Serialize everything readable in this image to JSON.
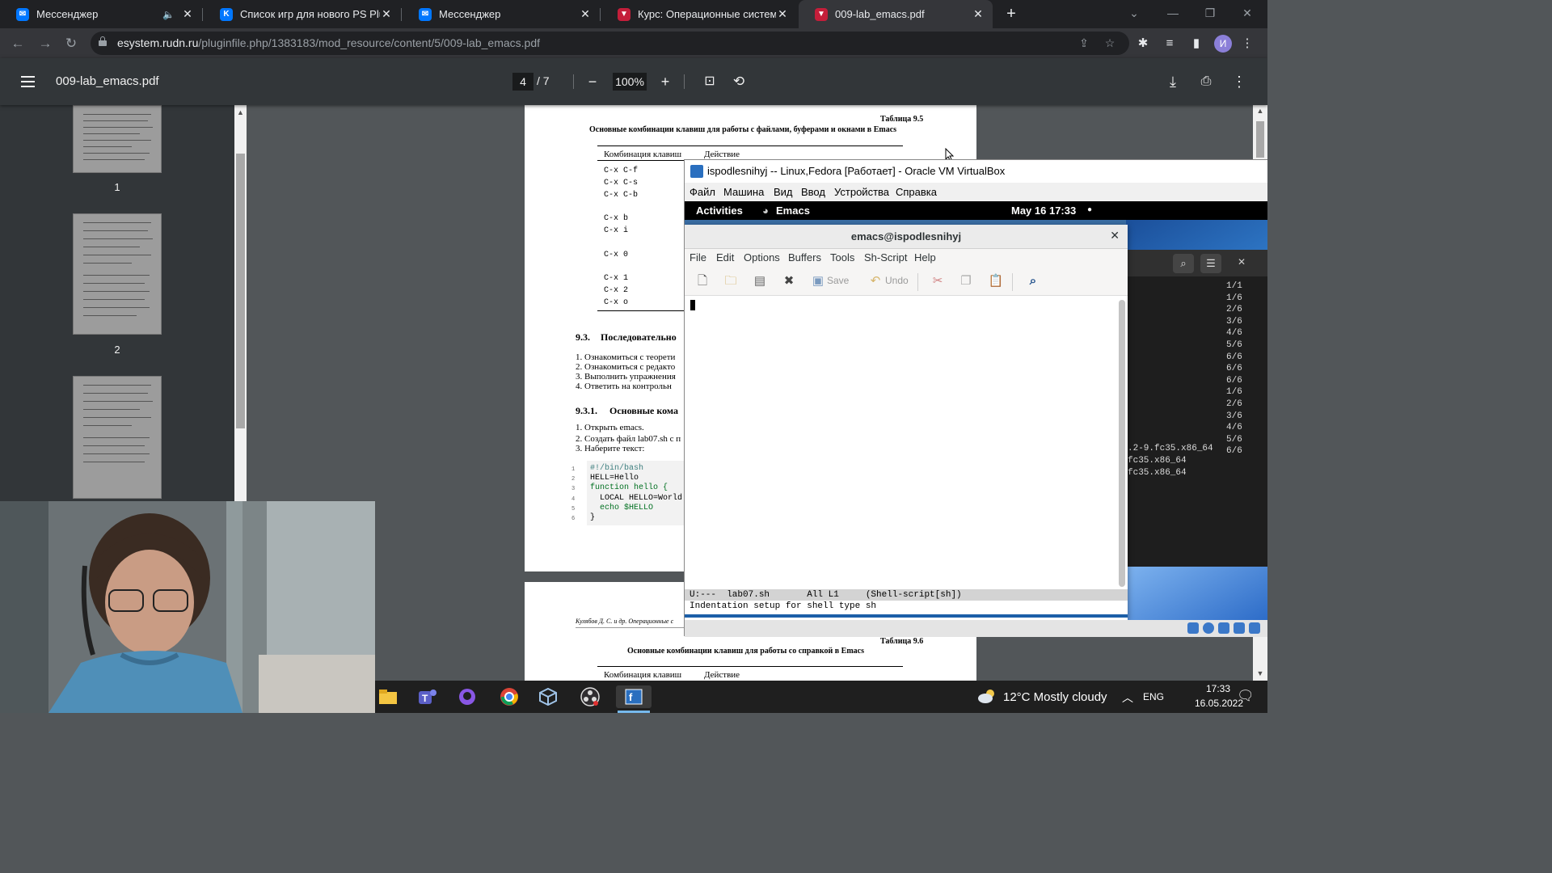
{
  "browser": {
    "tabs": [
      {
        "title": "Мессенджер",
        "icon": "vk-messenger-icon",
        "color": "#0077ff",
        "muted": true
      },
      {
        "title": "Список игр для нового PS Plus",
        "icon": "vk-icon",
        "color": "#0077ff"
      },
      {
        "title": "Мессенджер",
        "icon": "vk-messenger-icon",
        "color": "#0077ff"
      },
      {
        "title": "Курс: Операционные системы (",
        "icon": "rudn-icon",
        "color": "#c41e3a"
      },
      {
        "title": "009-lab_emacs.pdf",
        "icon": "rudn-icon",
        "color": "#c41e3a",
        "active": true
      }
    ],
    "url_host": "esystem.rudn.ru",
    "url_path": "/pluginfile.php/1383183/mod_resource/content/5/009-lab_emacs.pdf",
    "profile_initial": "И"
  },
  "pdf": {
    "filename": "009-lab_emacs.pdf",
    "current_page": "4",
    "total_pages": "/  7",
    "zoom": "100%",
    "thumbnails": [
      "1",
      "2"
    ]
  },
  "page": {
    "table_label": "Таблица 9.5",
    "table_title": "Основные комбинации клавиш для работы с файлами, буферами и окнами в Emacs",
    "col_keys": "Комбинация клавиш",
    "col_action": "Действие",
    "keys": [
      "C-x C-f",
      "C-x C-s",
      "C-x C-b",
      "C-x b",
      "C-x i",
      "C-x 0",
      "C-x 1",
      "C-x 2",
      "C-x o"
    ],
    "section": "9.3.",
    "section_title": "Последовательно",
    "steps": [
      "1.  Ознакомиться с теорети",
      "2.  Ознакомиться с редакто",
      "3.  Выполнить упражнения",
      "4.  Ответить на контрольн"
    ],
    "subsection": "9.3.1.",
    "subsection_title": "Основные кома",
    "substeps": [
      "1.  Открыть emacs.",
      "2.  Создать файл lab07.sh с п",
      "3.  Наберите текст:"
    ],
    "code_lines": [
      "#!/bin/bash",
      "HELL=Hello",
      "function hello {",
      "  LOCAL HELLO=World",
      "  echo $HELLO",
      "}"
    ],
    "code_nums": [
      "1",
      "2",
      "3",
      "4",
      "5",
      "6"
    ],
    "page2_footer": "Кулябов Д. С. и др.  Операционные с",
    "page2_label": "Таблица 9.6",
    "page2_title": "Основные комбинации клавиш для работы со справкой в Emacs",
    "page2_col_keys": "Комбинация клавиш",
    "page2_col_action": "Действие"
  },
  "vbox": {
    "title": "ispodlesnihyj -- Linux,Fedora [Работает] - Oracle VM VirtualBox",
    "menu": [
      "Файл",
      "Машина",
      "Вид",
      "Ввод",
      "Устройства",
      "Справка"
    ]
  },
  "gnome": {
    "activities": "Activities",
    "app": "Emacs",
    "clock": "May 16  17:33"
  },
  "emacs": {
    "title": "emacs@ispodlesnihyj",
    "menu": [
      "File",
      "Edit",
      "Options",
      "Buffers",
      "Tools",
      "Sh-Script",
      "Help"
    ],
    "save_label": "Save",
    "undo_label": "Undo",
    "modeline": "U:---  lab07.sh       All L1     (Shell-script[sh])",
    "minibuffer": "Indentation setup for shell type sh"
  },
  "terminal": {
    "right_col": [
      "1/1",
      "1/6",
      "2/6",
      "3/6",
      "4/6",
      "5/6",
      "6/6",
      "6/6",
      "6/6",
      "1/6",
      "2/6",
      "3/6",
      "4/6",
      "5/6",
      "6/6"
    ],
    "lines": [
      ".2-9.fc35.x86_64",
      "fc35.x86_64",
      "fc35.x86_64"
    ]
  },
  "taskbar": {
    "weather": "12°C  Mostly cloudy",
    "lang": "ENG",
    "time": "17:33",
    "date": "16.05.2022"
  }
}
